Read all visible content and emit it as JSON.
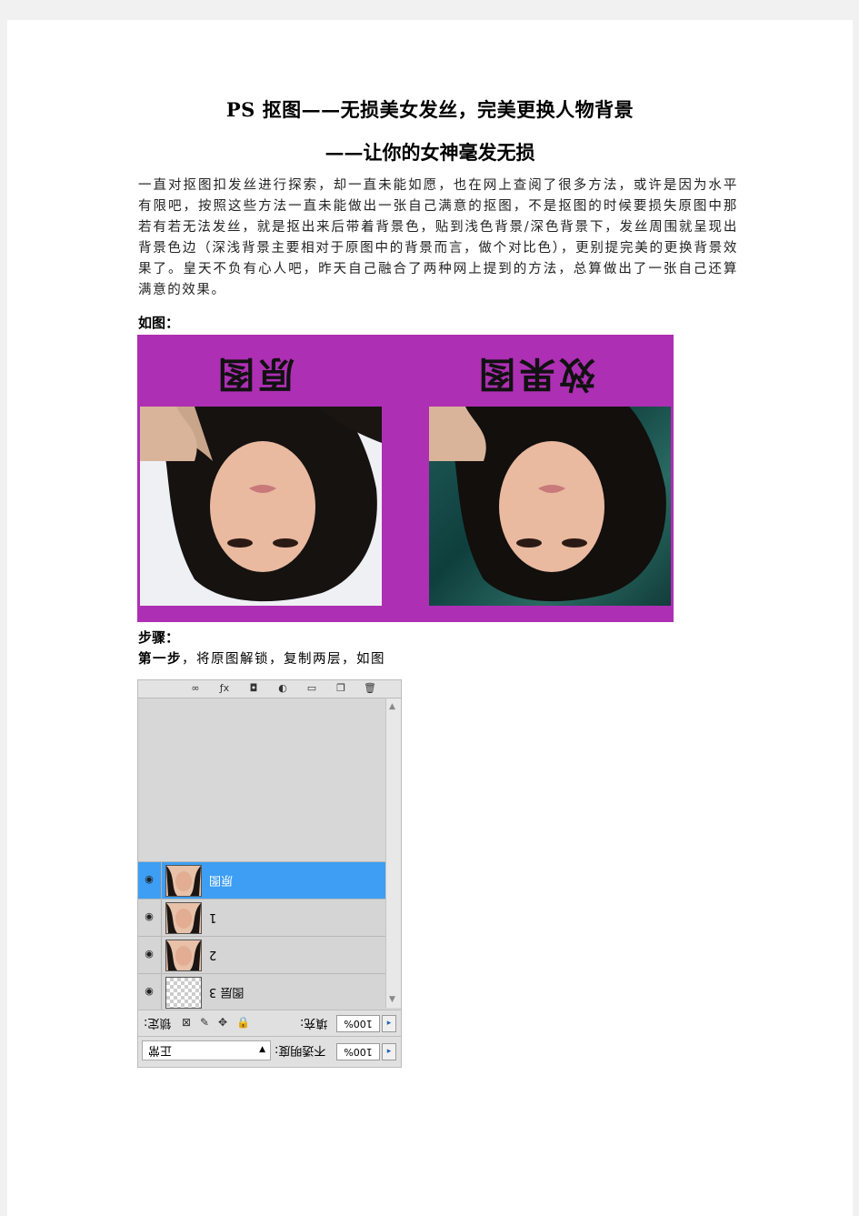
{
  "document": {
    "title_line1": "PS 抠图——无损美女发丝，完美更换人物背景",
    "title_line2": "——让你的女神毫发无损",
    "paragraph": "一直对抠图扣发丝进行探索，却一直未能如愿，也在网上查阅了很多方法，或许是因为水平有限吧，按照这些方法一直未能做出一张自己满意的抠图，不是抠图的时候要损失原图中那若有若无法发丝，就是抠出来后带着背景色，贴到浅色背景/深色背景下，发丝周围就呈现出背景色边（深浅背景主要相对于原图中的背景而言，做个对比色），更别提完美的更换背景效果了。皇天不负有心人吧，昨天自己融合了两种网上提到的方法，总算做出了一张自己还算满意的效果。",
    "figure_label": "如图：",
    "steps_heading": "步骤：",
    "step1_bold": "第一步",
    "step1_text": "，将原图解锁，复制两层，如图"
  },
  "comparison_image": {
    "left_heading": "原图",
    "right_heading": "效果图",
    "background_color": "#ad2fb3"
  },
  "layers_panel": {
    "toolbar_icons": [
      "link-icon",
      "fx-icon",
      "mask-icon",
      "adjustment-icon",
      "group-icon",
      "new-layer-icon",
      "trash-icon"
    ],
    "layers": [
      {
        "name": "原图",
        "selected": true,
        "thumb": "photo"
      },
      {
        "name": "1",
        "selected": false,
        "thumb": "photo"
      },
      {
        "name": "2",
        "selected": false,
        "thumb": "photo"
      },
      {
        "name": "图层 3",
        "selected": false,
        "thumb": "transparent"
      }
    ],
    "lock_label": "锁定:",
    "fill_label": "填充:",
    "fill_value": "100%",
    "blend_mode": "正常",
    "opacity_label": "不透明度:",
    "opacity_value": "100%"
  }
}
